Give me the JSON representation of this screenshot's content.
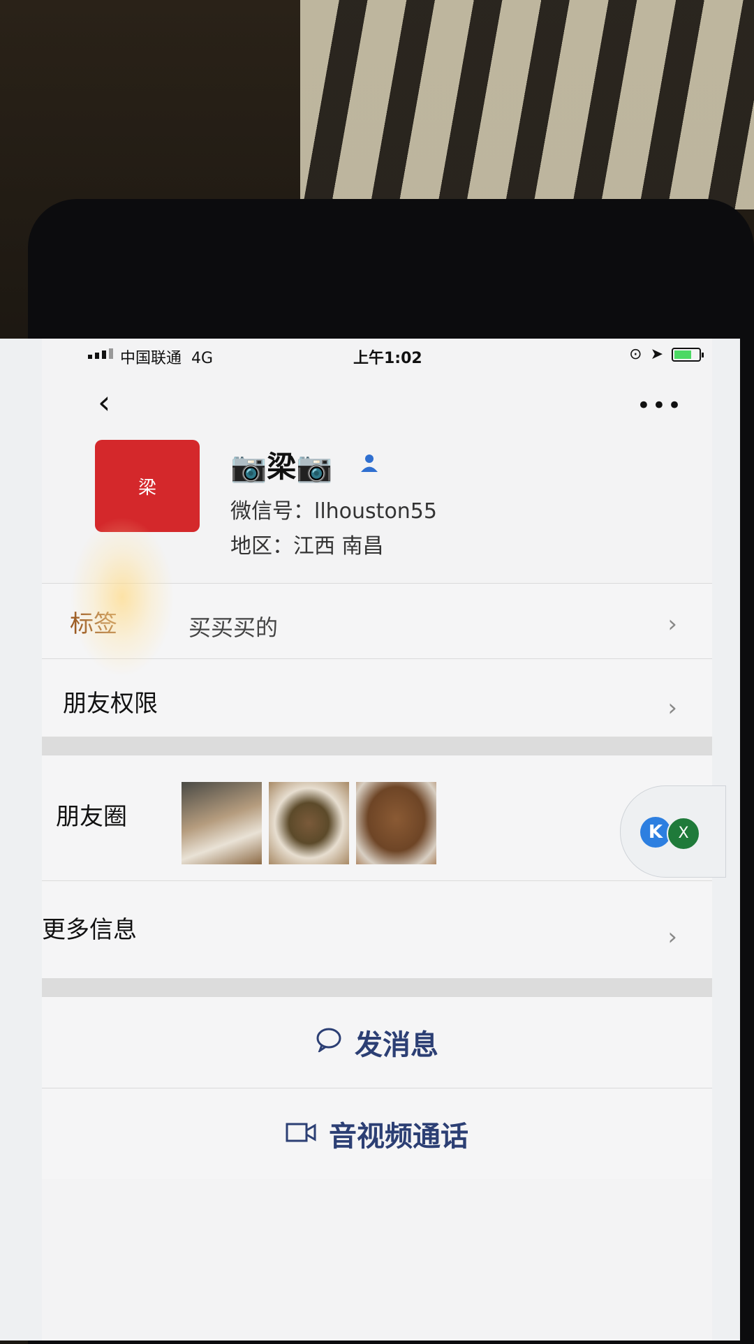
{
  "status_bar": {
    "carrier": "中国联通",
    "network": "4G",
    "time": "上午1:02"
  },
  "profile": {
    "avatar_text": "梁",
    "nickname": "📷梁📷",
    "wechat_id": "微信号：llhouston55",
    "region": "地区：江西 南昌"
  },
  "rows": {
    "tags_label": "标签",
    "tags_value": "买买买的",
    "permissions_label": "朋友权限",
    "moments_label": "朋友圈",
    "more_info_label": "更多信息"
  },
  "actions": {
    "send_message": "发消息",
    "video_call": "音视频通话"
  },
  "floating": {
    "k_letter": "K",
    "x_letter": "X"
  },
  "icons": [
    "back-icon",
    "more-icon",
    "contact-icon",
    "chevron-right-icon",
    "chat-bubble-icon",
    "video-camera-icon"
  ],
  "colors": {
    "avatar_bg": "#d4282b",
    "tag_label": "#9b5a22",
    "action_text": "#2c3f74",
    "contact_icon": "#2f6fd0"
  }
}
